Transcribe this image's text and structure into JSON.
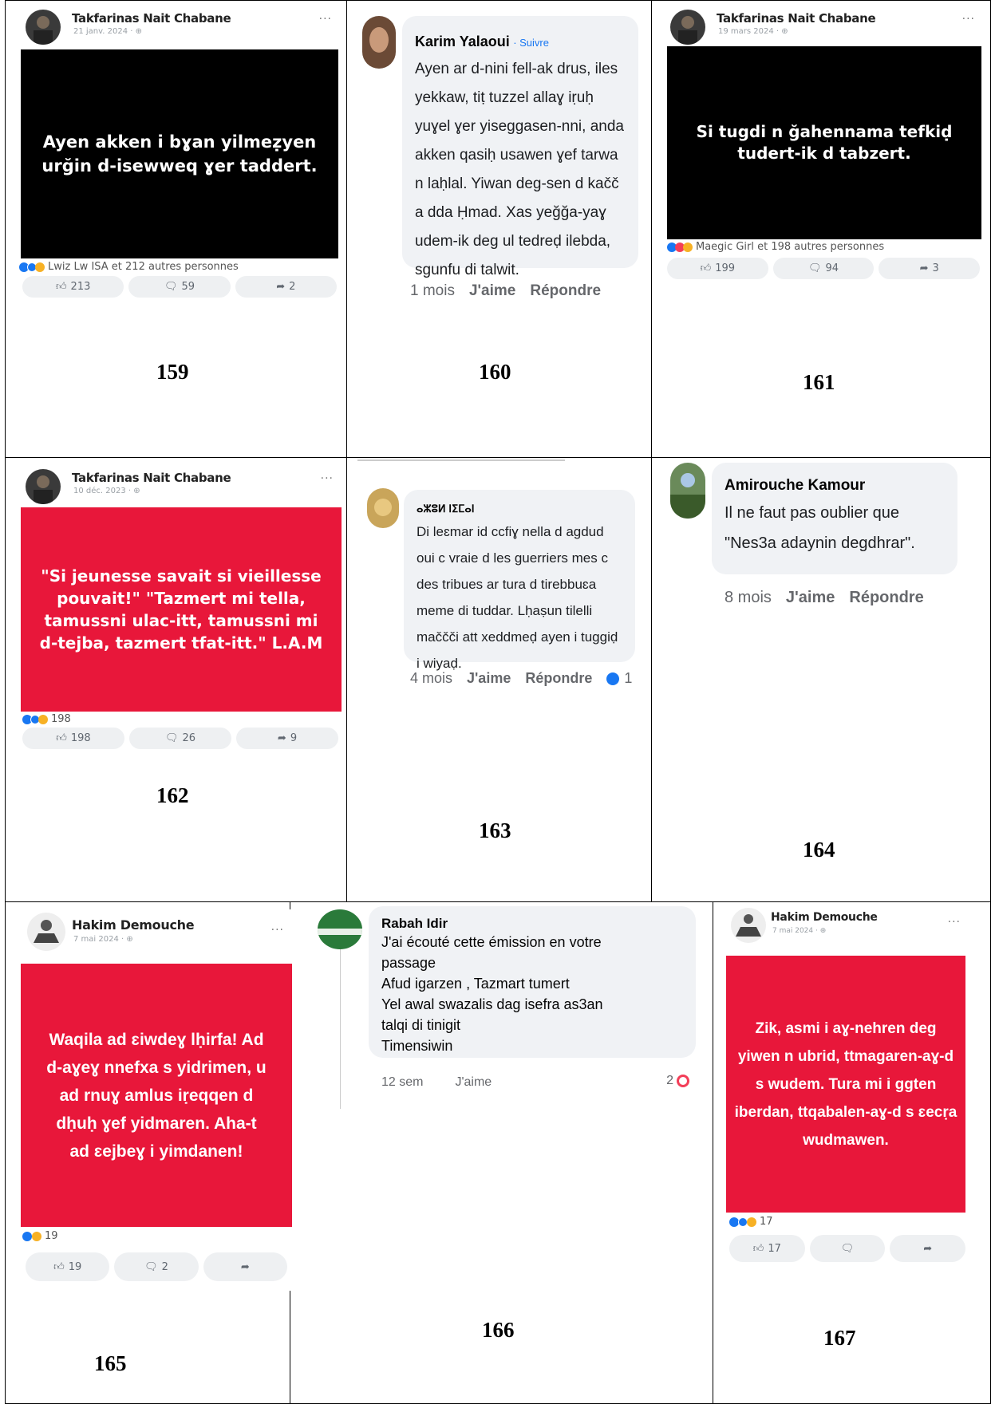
{
  "figures": [
    {
      "number": "159",
      "author": "Takfarinas Nait Chabane",
      "date": "21 janv. 2024 · ",
      "banner_text": "Ayen akken i bɣan yilmeẓyen urğin d-isewweq ɣer taddert.",
      "banner_color": "#000000",
      "reactions_text": "Lwiz Lw ISA et 212 autres personnes",
      "likes": "213",
      "comments": "59",
      "shares": "2"
    },
    {
      "number": "160",
      "author": "Karim Yalaoui",
      "follow": "· Suivre",
      "text": "Ayen ar d-nini fell-ak drus, iles yekkaw, tiṭ tuzzel allaɣ iṛuḥ yuɣel ɣer yiseggasen-nni, anda akken qasiḥ usawen ɣef tarwa n laḥlal. Yiwan deg-sen d kačč a dda Ḥmad. Xas yeğğa-yaɣ udem-ik deg ul tedreḍ ilebda, sgunfu di talwit.",
      "time": "1 mois",
      "like": "J'aime",
      "reply": "Répondre"
    },
    {
      "number": "161",
      "author": "Takfarinas Nait Chabane",
      "date": "19 mars 2024 · ",
      "banner_text": "Si tugdi n ğahennama tefkiḍ tudert-ik d tabzert.",
      "banner_color": "#000000",
      "reactions_text": "Maegic Girl et 198 autres personnes",
      "likes": "199",
      "comments": "94",
      "shares": "3"
    },
    {
      "number": "162",
      "author": "Takfarinas Nait Chabane",
      "date": "10 déc. 2023 · ",
      "banner_text": "\"Si jeunesse savait si vieillesse pouvait!\" \"Tazmert mi tella, tamussni ulac-itt, tamussni mi d-tejba, tazmert tfat-itt.\" L.A.M",
      "banner_color": "#e8173a",
      "reactions_text": "198",
      "likes": "198",
      "comments": "26",
      "shares": "9"
    },
    {
      "number": "163",
      "author": "ⴰⵣⵓⵍ ⵏⵉⵎⴰⵏ",
      "text": "Di leɛmar id ccfiɣ nella d agdud oui c vraie d les guerriers mes c des tribues ar tura d tirebbuɛa meme di tuddar. Lḥaṣun tilelli maččči att xeddmeḍ ayen i tuggiḍ i wiyaḍ.",
      "time": "4 mois",
      "like": "J'aime",
      "reply": "Répondre",
      "likes": "1"
    },
    {
      "number": "164",
      "author": "Amirouche Kamour",
      "text": "Il ne faut pas oublier que \"Nes3a adaynin degdhrar\".",
      "time": "8 mois",
      "like": "J'aime",
      "reply": "Répondre"
    },
    {
      "number": "165",
      "author": "Hakim Demouche",
      "date": "7 mai 2024 · ",
      "banner_text": "Waqila ad ɛiwdeɣ lḥirfa! Ad d-aɣeɣ nnefxa s yidrimen, u ad rnuɣ amlus iṛeqqen d dḥuḥ ɣef yidmaren. Aha-t ad ɛejbeɣ i yimdanen!",
      "banner_color": "#e8173a",
      "reactions_text": "19",
      "likes": "19",
      "comments": "2",
      "shares": ""
    },
    {
      "number": "166",
      "author": "Rabah Idir",
      "lines": [
        "J'ai écouté cette émission en votre",
        "passage",
        "Afud igarzen , Tazmart tumert",
        "Yel awal swazalis dag isefra as3an",
        "talqi di tinigit",
        "Timensiwin"
      ],
      "time": "12 sem",
      "like": "J'aime",
      "likes": "2"
    },
    {
      "number": "167",
      "author": "Hakim Demouche",
      "date": "7 mai 2024 · ",
      "banner_text": "Zik, asmi i aɣ-nehren deg yiwen n ubrid, ttmagaren-aɣ-d s wudem. Tura mi i ggten iberdan, ttqabalen-aɣ-d s ɛecṛa wudmawen.",
      "banner_color": "#e8173a",
      "reactions_text": "17",
      "likes": "17",
      "comments": "",
      "shares": ""
    }
  ],
  "colors": {
    "like_blue": "#1877f2",
    "love_red": "#f33e58",
    "haha_yellow": "#f7b125",
    "facebook_grey": "#f0f2f5"
  }
}
